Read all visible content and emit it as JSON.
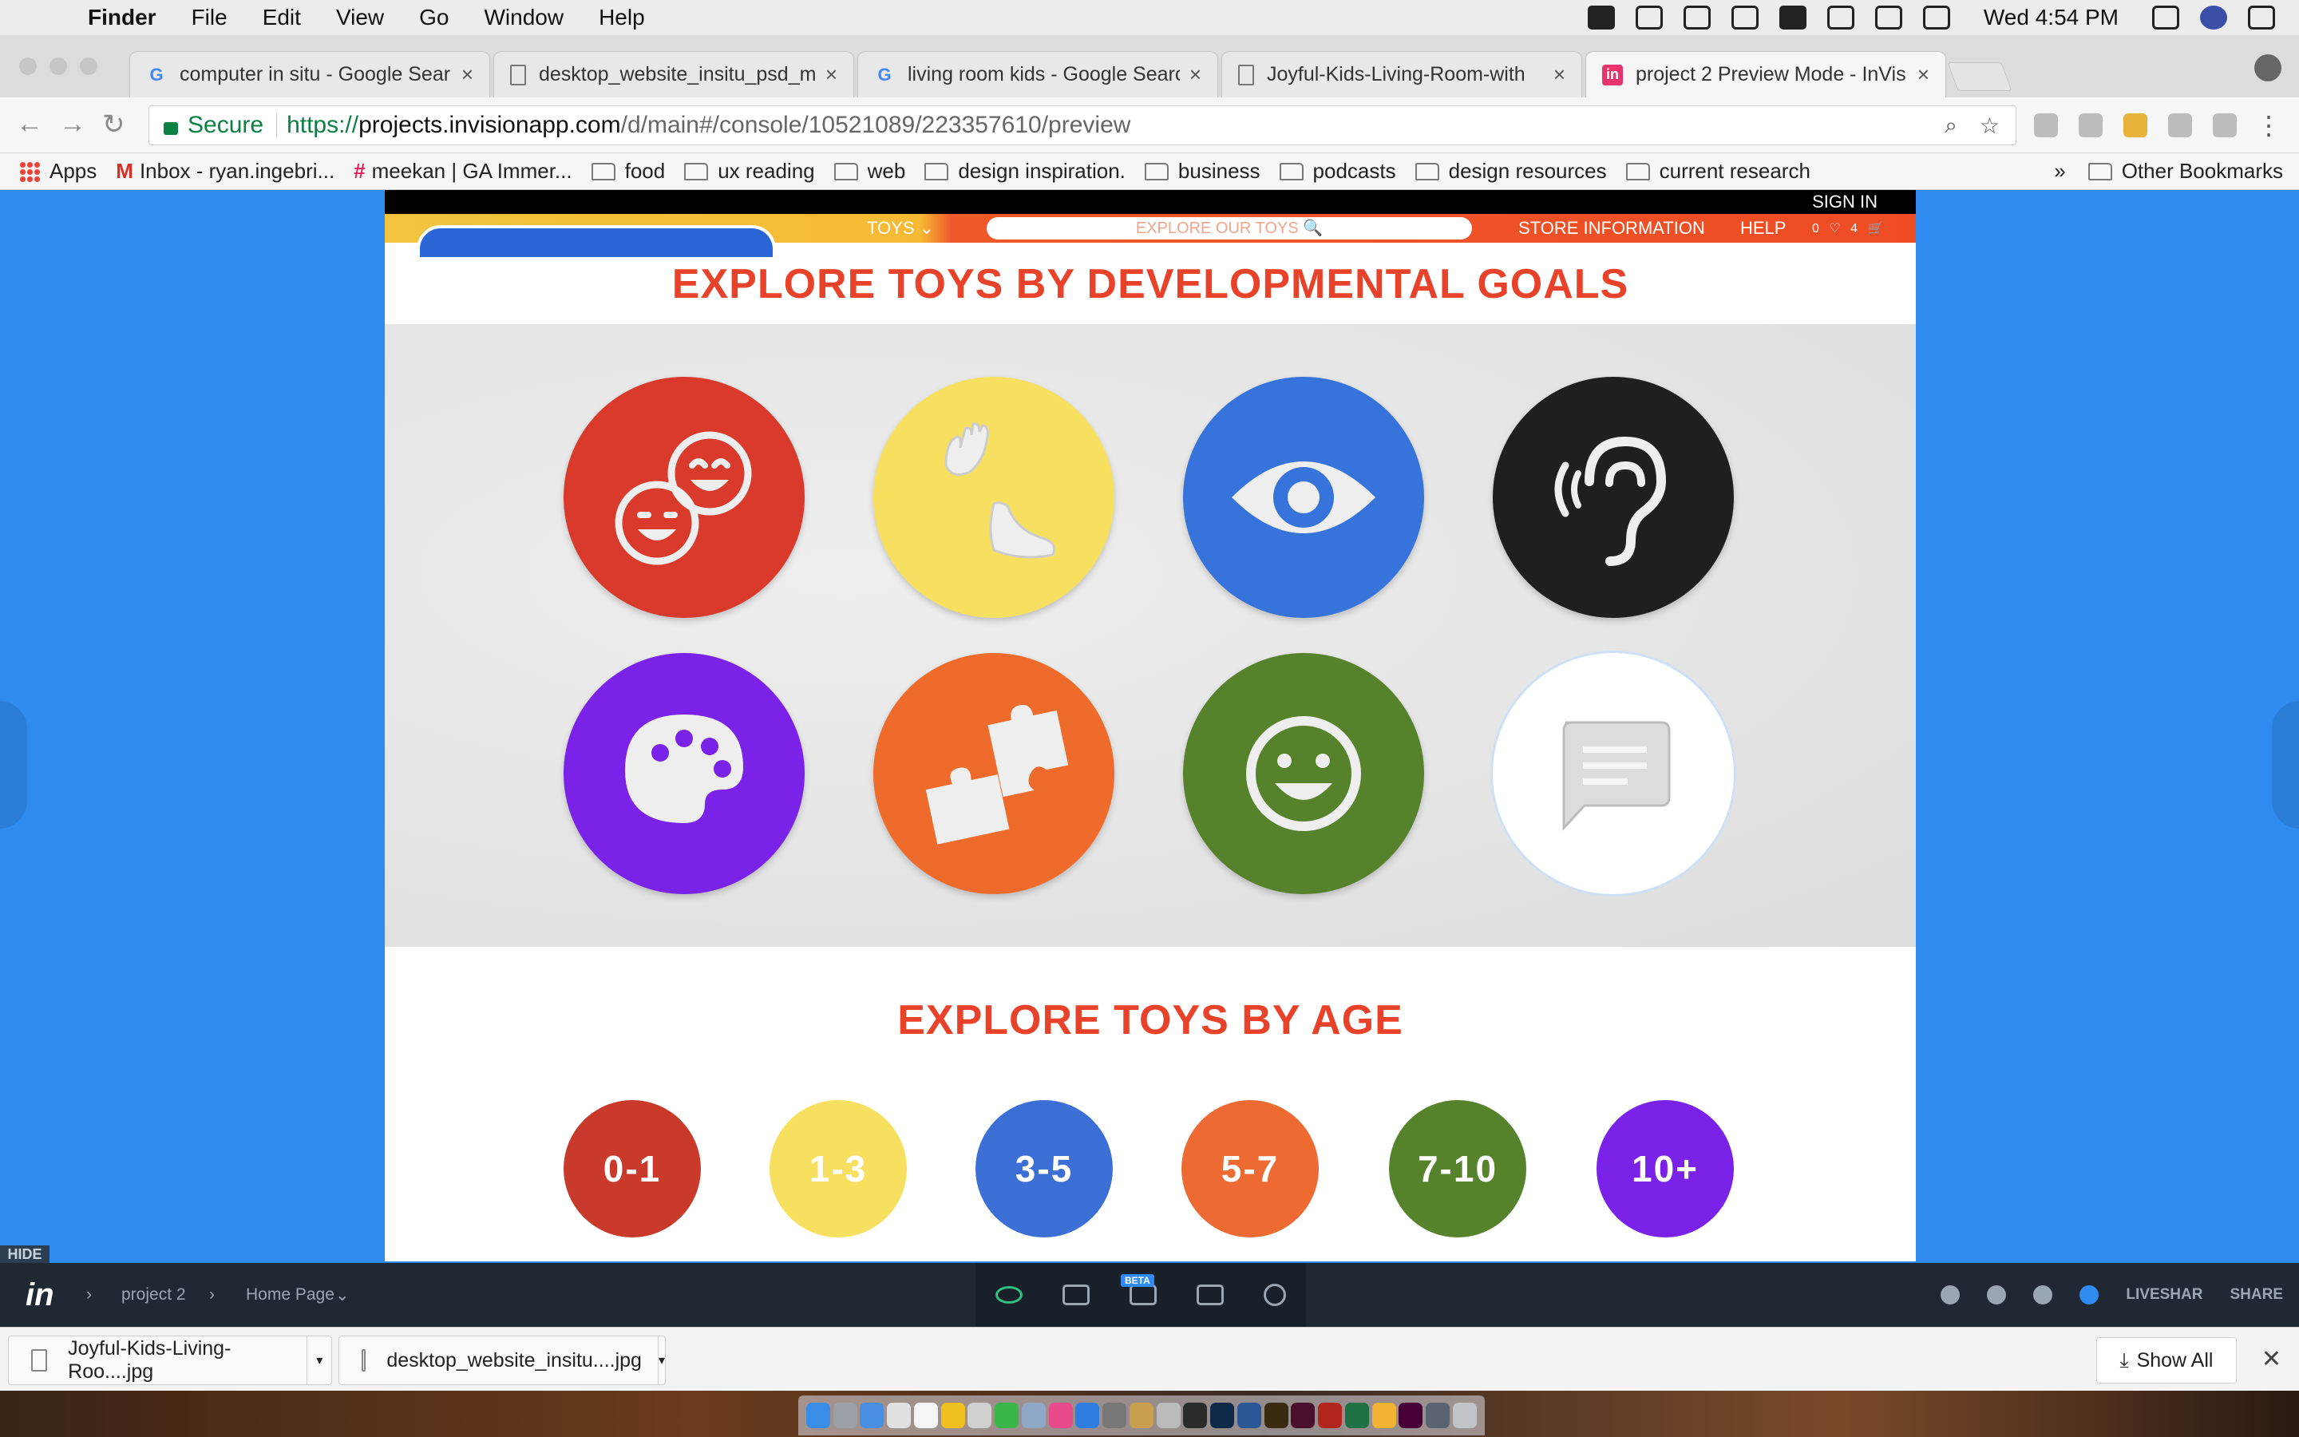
{
  "menubar": {
    "apple": "",
    "app": "Finder",
    "items": [
      "File",
      "Edit",
      "View",
      "Go",
      "Window",
      "Help"
    ],
    "clock": "Wed 4:54 PM"
  },
  "tabs": [
    {
      "label": "computer in situ - Google Sear",
      "icon": "google-icon"
    },
    {
      "label": "desktop_website_insitu_psd_m",
      "icon": "document-icon"
    },
    {
      "label": "living room kids - Google Searc",
      "icon": "google-icon"
    },
    {
      "label": "Joyful-Kids-Living-Room-with",
      "icon": "document-icon"
    },
    {
      "label": "project 2 Preview Mode - InVis",
      "icon": "invision-icon",
      "active": true
    }
  ],
  "address": {
    "secure": "Secure",
    "proto": "https://",
    "host": "projects.invisionapp.com",
    "path": "/d/main#/console/10521089/223357610/preview"
  },
  "bookmarks": {
    "items": [
      "Apps",
      "Inbox - ryan.ingebri...",
      "meekan | GA Immer...",
      "food",
      "ux reading",
      "web",
      "design inspiration.",
      "business",
      "podcasts",
      "design resources",
      "current research"
    ],
    "overflow": "»",
    "other": "Other Bookmarks"
  },
  "site": {
    "sign_in": "SIGN IN",
    "nav": {
      "toys": "TOYS ⌄",
      "search_placeholder": "EXPLORE OUR TOYS 🔍",
      "store": "STORE INFORMATION",
      "help": "HELP",
      "icons": "0 ♡ 4 🛒"
    },
    "goals_title": "EXPLORE TOYS BY DEVELOPMENTAL GOALS",
    "goals": [
      {
        "icon": "two-smiles-icon",
        "color": "#d93a2b"
      },
      {
        "icon": "hand-and-foot-icon",
        "color": "#f7e060"
      },
      {
        "icon": "eye-icon",
        "color": "#3673db"
      },
      {
        "icon": "ear-icon",
        "color": "#1f1f1f"
      },
      {
        "icon": "palette-icon",
        "color": "#7a22e8"
      },
      {
        "icon": "puzzle-icon",
        "color": "#ee6b2c"
      },
      {
        "icon": "smile-icon",
        "color": "#56822c"
      },
      {
        "icon": "speech-bubble-icon",
        "color": "#ffffff"
      }
    ],
    "age_title": "EXPLORE TOYS BY AGE",
    "ages": [
      {
        "label": "0-1",
        "color": "#c93a2a"
      },
      {
        "label": "1-3",
        "color": "#f7e060"
      },
      {
        "label": "3-5",
        "color": "#3b6fd6"
      },
      {
        "label": "5-7",
        "color": "#ed6b33"
      },
      {
        "label": "7-10",
        "color": "#56822c"
      },
      {
        "label": "10+",
        "color": "#7a22e8"
      }
    ]
  },
  "invision": {
    "hide": "HIDE",
    "logo": "in",
    "project": "project 2",
    "screen": "Home Page",
    "beta": "BETA",
    "liveshare": "LIVESHAR",
    "share": "SHARE"
  },
  "downloads": {
    "files": [
      "Joyful-Kids-Living-Roo....jpg",
      "desktop_website_insitu....jpg"
    ],
    "show_all": "Show All",
    "close": "✕"
  }
}
